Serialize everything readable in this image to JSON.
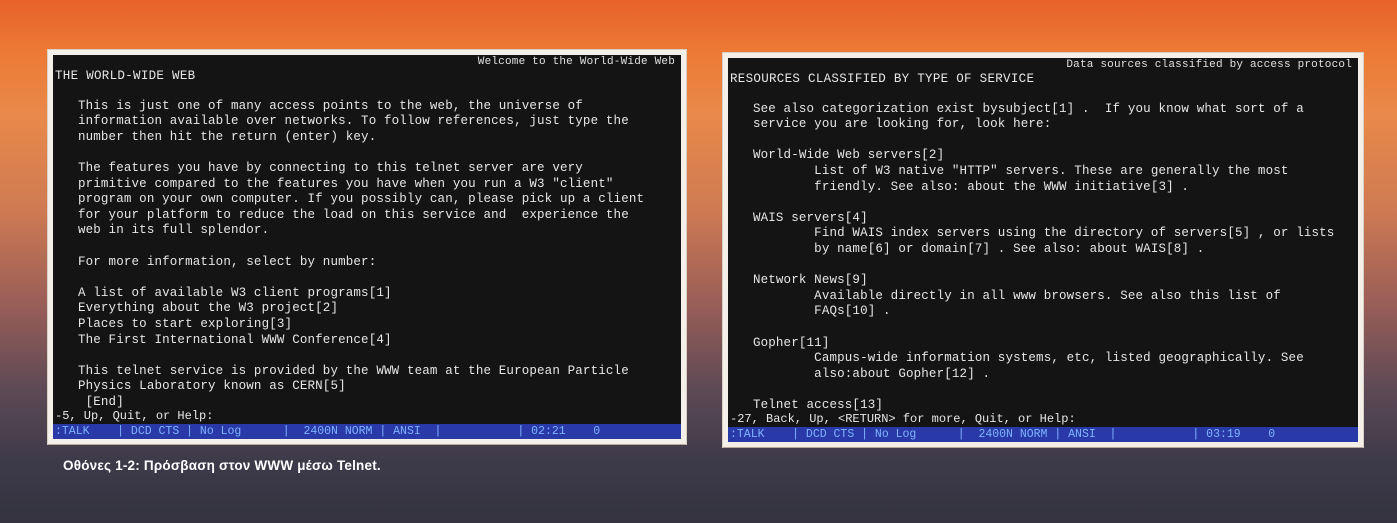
{
  "left_screen": {
    "title": "Welcome to the World-Wide Web",
    "heading": "THE WORLD-WIDE WEB",
    "lines": [
      "",
      "   This is just one of many access points to the web, the universe of",
      "   information available over networks. To follow references, just type the",
      "   number then hit the return (enter) key.",
      "",
      "   The features you have by connecting to this telnet server are very",
      "   primitive compared to the features you have when you run a W3 \"client\"",
      "   program on your own computer. If you possibly can, please pick up a client",
      "   for your platform to reduce the load on this service and  experience the",
      "   web in its full splendor.",
      "",
      "   For more information, select by number:",
      "",
      "   A list of available W3 client programs[1]",
      "   Everything about the W3 project[2]",
      "   Places to start exploring[3]",
      "   The First International WWW Conference[4]",
      "",
      "   This telnet service is provided by the WWW team at the European Particle",
      "   Physics Laboratory known as CERN[5]",
      "    [End]"
    ],
    "prompt": "-5, Up, Quit, or Help:",
    "status": ":TALK    | DCD CTS | No Log      |  2400N NORM | ANSI  |           | 02:21    0"
  },
  "right_screen": {
    "title": "Data sources classified by access protocol",
    "heading": "RESOURCES CLASSIFIED BY TYPE OF SERVICE",
    "lines": [
      "",
      "   See also categorization exist bysubject[1] .  If you know what sort of a",
      "   service you are looking for, look here:",
      "",
      "   World-Wide Web servers[2]",
      "           List of W3 native \"HTTP\" servers. These are generally the most",
      "           friendly. See also: about the WWW initiative[3] .",
      "",
      "   WAIS servers[4]",
      "           Find WAIS index servers using the directory of servers[5] , or lists",
      "           by name[6] or domain[7] . See also: about WAIS[8] .",
      "",
      "   Network News[9]",
      "           Available directly in all www browsers. See also this list of",
      "           FAQs[10] .",
      "",
      "   Gopher[11]",
      "           Campus-wide information systems, etc, listed geographically. See",
      "           also:about Gopher[12] .",
      "",
      "   Telnet access[13]"
    ],
    "prompt": "-27, Back, Up, <RETURN> for more, Quit, or Help:",
    "status": ":TALK    | DCD CTS | No Log      |  2400N NORM | ANSI  |           | 03:19    0"
  },
  "caption": "Οθόνες 1-2: Πρόσβαση στον WWW μέσω Telnet.",
  "colors": {
    "screen_bg": "#141414",
    "status_bar": "#2a39a8",
    "frame": "#f4efe8"
  }
}
